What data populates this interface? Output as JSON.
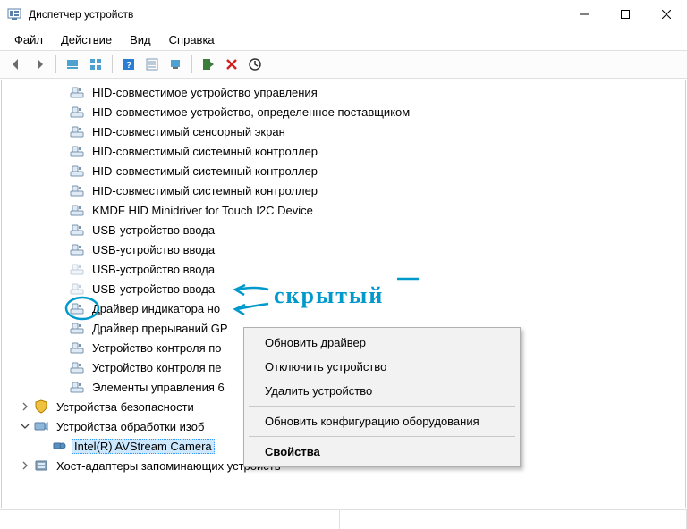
{
  "title": "Диспетчер устройств",
  "menu": {
    "file": "Файл",
    "action": "Действие",
    "view": "Вид",
    "help": "Справка"
  },
  "tree": {
    "items": [
      {
        "label": "HID-совместимое устройство управления",
        "type": "hid"
      },
      {
        "label": "HID-совместимое устройство, определенное поставщиком",
        "type": "hid"
      },
      {
        "label": "HID-совместимый сенсорный экран",
        "type": "hid"
      },
      {
        "label": "HID-совместимый системный контроллер",
        "type": "hid"
      },
      {
        "label": "HID-совместимый системный контроллер",
        "type": "hid"
      },
      {
        "label": "HID-совместимый системный контроллер",
        "type": "hid"
      },
      {
        "label": "KMDF HID Minidriver for Touch I2C Device",
        "type": "hid"
      },
      {
        "label": "USB-устройство ввода",
        "type": "hid"
      },
      {
        "label": "USB-устройство ввода",
        "type": "hid"
      },
      {
        "label": "USB-устройство ввода",
        "type": "hid",
        "dimmed": true
      },
      {
        "label": "USB-устройство ввода",
        "type": "hid",
        "dimmed": true,
        "circled": true
      },
      {
        "label": "Драйвер индикатора но",
        "type": "hid"
      },
      {
        "label": "Драйвер прерываний GP",
        "type": "hid"
      },
      {
        "label": "Устройство контроля по",
        "type": "hid"
      },
      {
        "label": "Устройство контроля пе",
        "type": "hid"
      },
      {
        "label": "Элементы управления 6",
        "type": "hid"
      }
    ],
    "cat_security": "Устройства безопасности",
    "cat_imaging": "Устройства обработки изоб",
    "cam": "Intel(R) AVStream Camera",
    "cat_host": "Хост-адаптеры запоминающих устройств"
  },
  "context_menu": {
    "update_driver": "Обновить драйвер",
    "disable_device": "Отключить устройство",
    "uninstall_device": "Удалить устройство",
    "scan_hw": "Обновить конфигурацию оборудования",
    "properties": "Свойства"
  },
  "annotation": {
    "text": "скрытый"
  }
}
